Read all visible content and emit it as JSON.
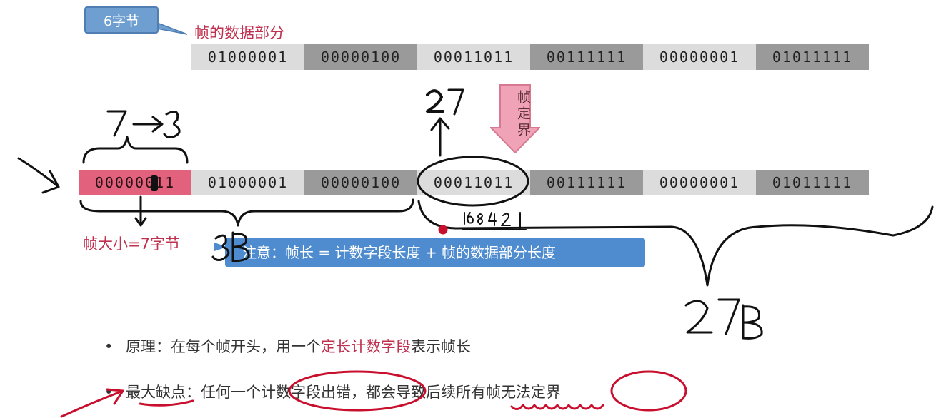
{
  "callout_6byte": "6字节",
  "label_frame_data": "帧的数据部分",
  "row1": [
    "01000001",
    "00000100",
    "00011011",
    "00111111",
    "00000001",
    "01011111"
  ],
  "row1_shades": [
    "light",
    "dark",
    "light",
    "dark",
    "light",
    "dark"
  ],
  "row2": [
    "00000011",
    "01000001",
    "00000100",
    "00011011",
    "00111111",
    "00000001",
    "01011111"
  ],
  "row2_shades": [
    "pink",
    "light",
    "dark",
    "light",
    "dark",
    "light",
    "dark"
  ],
  "arrow_label": "帧定界",
  "label_frame_size": "帧大小=7字节",
  "note": "注意：帧长 = 计数字段长度 + 帧的数据部分长度",
  "bullet1": {
    "a": "原理：在每个帧开头，用一个",
    "red": "定长计数字段",
    "b": "表示帧长"
  },
  "bullet2": "最大缺点：任何一个计数字段出错，都会导致后续所有帧无法定界",
  "handwritten": {
    "top_left": "7 → 3",
    "above_circle": "27",
    "sum": "16 8 4 2 1",
    "left_3b": "3B",
    "right_27b": "27B"
  },
  "colors": {
    "pink": "#e2627d",
    "blue": "#4f8ccf",
    "red_text": "#c0304f",
    "ink": "#111111",
    "pen_red": "#c8102e"
  }
}
